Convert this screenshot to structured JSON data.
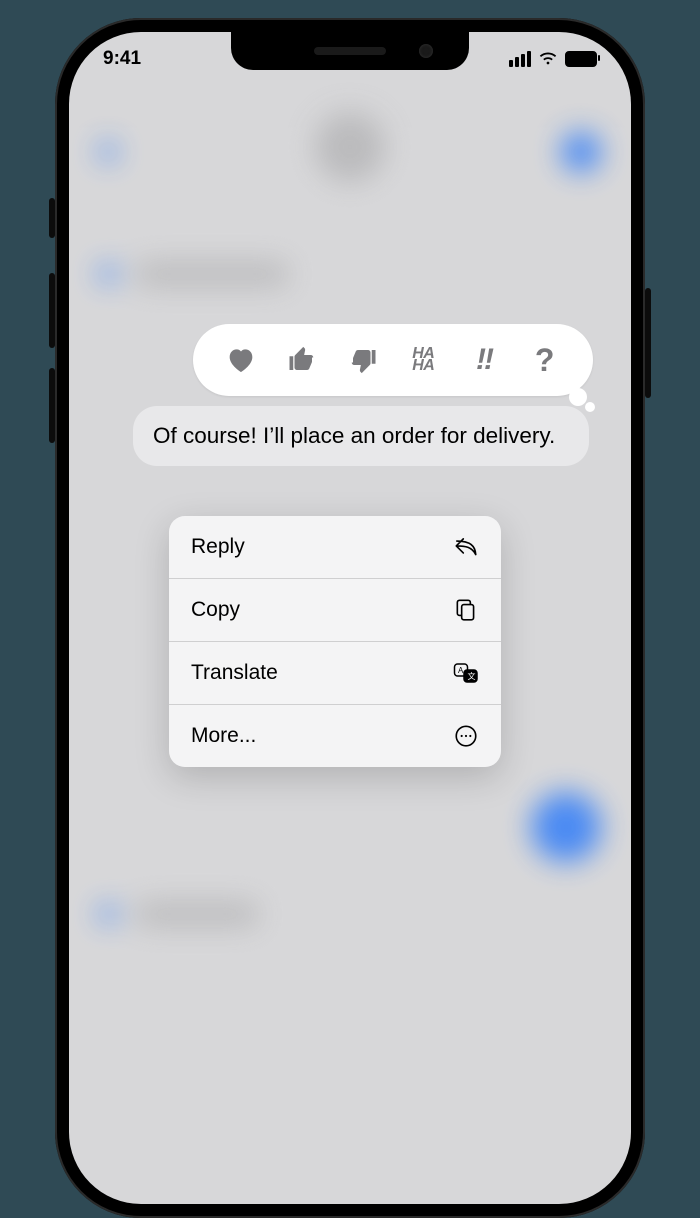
{
  "status": {
    "time": "9:41"
  },
  "tapback": {
    "heart": "heart",
    "thumbs_up": "thumbs-up",
    "thumbs_down": "thumbs-down",
    "haha_line1": "HA",
    "haha_line2": "HA",
    "exclaim": "!!",
    "question": "?"
  },
  "message": {
    "text": "Of course! I’ll place an order for delivery."
  },
  "menu": {
    "reply": "Reply",
    "copy": "Copy",
    "translate": "Translate",
    "more": "More..."
  }
}
